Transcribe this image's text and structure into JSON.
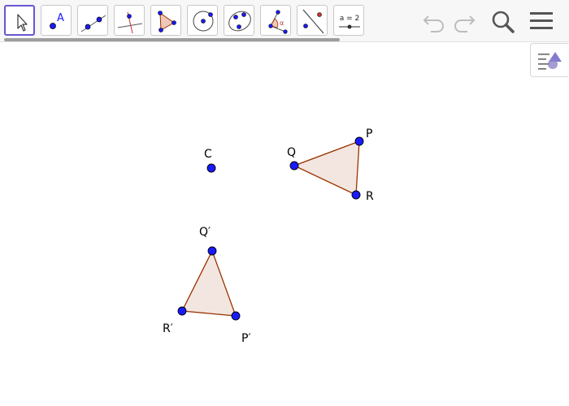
{
  "toolbar": {
    "tools": [
      {
        "name": "move-tool",
        "icon": "pointer-icon"
      },
      {
        "name": "point-tool",
        "icon": "point-icon",
        "letter": "A"
      },
      {
        "name": "line-tool",
        "icon": "line-icon"
      },
      {
        "name": "perpendicular-line-tool",
        "icon": "perpendicular-icon"
      },
      {
        "name": "polygon-tool",
        "icon": "polygon-icon"
      },
      {
        "name": "circle-tool",
        "icon": "circle-icon"
      },
      {
        "name": "ellipse-tool",
        "icon": "ellipse-icon"
      },
      {
        "name": "angle-tool",
        "icon": "angle-icon",
        "letter": "α"
      },
      {
        "name": "reflect-tool",
        "icon": "reflect-icon"
      },
      {
        "name": "slider-tool",
        "icon": "slider-icon",
        "label": "a = 2"
      }
    ],
    "undo_icon": "undo-icon",
    "redo_icon": "redo-icon",
    "search_icon": "search-icon",
    "menu_icon": "menu-icon",
    "side_panel_icon": "style-bar-icon"
  },
  "colors": {
    "point": "#1a1aff",
    "edge": "#993300",
    "fill": "#f3e6e0",
    "active_tool": "#6557d2"
  },
  "geometry": {
    "points": [
      {
        "label": "C"
      },
      {
        "label": "Q"
      },
      {
        "label": "P"
      },
      {
        "label": "R"
      },
      {
        "label": "Q′"
      },
      {
        "label": "R′"
      },
      {
        "label": "P′"
      }
    ],
    "polygons": [
      {
        "name": "triangle-PQR"
      },
      {
        "name": "triangle-P'Q'R'"
      }
    ]
  }
}
